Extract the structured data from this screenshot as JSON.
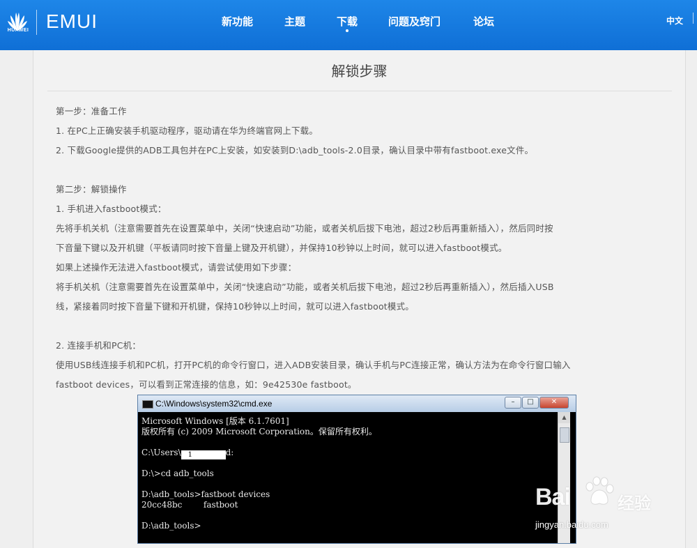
{
  "header": {
    "brand_text": "HUAWEI",
    "product_text": "EMUI",
    "nav": [
      {
        "label": "新功能",
        "active": false
      },
      {
        "label": "主题",
        "active": false
      },
      {
        "label": "下载",
        "active": true
      },
      {
        "label": "问题及窍门",
        "active": false
      },
      {
        "label": "论坛",
        "active": false
      }
    ],
    "language": "中文",
    "colors": {
      "bar": "#1676e0",
      "text": "#ffffff"
    }
  },
  "article": {
    "title": "解锁步骤",
    "lines": [
      "第一步：准备工作",
      "1. 在PC上正确安装手机驱动程序，驱动请在华为终端官网上下载。",
      "2. 下载Google提供的ADB工具包并在PC上安装，如安装到D:\\adb_tools-2.0目录，确认目录中带有fastboot.exe文件。",
      "",
      "第二步：解锁操作",
      "1. 手机进入fastboot模式：",
      "先将手机关机（注意需要首先在设置菜单中，关闭“快速启动”功能，或者关机后拔下电池，超过2秒后再重新插入），然后同时按",
      "下音量下键以及开机键（平板请同时按下音量上键及开机键），并保持10秒钟以上时间，就可以进入fastboot模式。",
      "如果上述操作无法进入fastboot模式，请尝试使用如下步骤：",
      "将手机关机（注意需要首先在设置菜单中，关闭“快速启动”功能，或者关机后拔下电池，超过2秒后再重新插入），然后插入USB",
      "线，紧接着同时按下音量下键和开机键，保持10秒钟以上时间，就可以进入fastboot模式。",
      "",
      "2. 连接手机和PC机：",
      "使用USB线连接手机和PC机，打开PC机的命令行窗口，进入ADB安装目录，确认手机与PC连接正常，确认方法为在命令行窗口输入",
      "fastboot devices，可以看到正常连接的信息，如：9e42530e fastboot。"
    ]
  },
  "cmd_window": {
    "title": "C:\\Windows\\system32\\cmd.exe",
    "buttons": {
      "minimize": "–",
      "maximize": "□",
      "close": "✕"
    },
    "lines": [
      "Microsoft Windows [版本 6.1.7601]",
      "版权所有 (c) 2009 Microsoft Corporation。保留所有权利。",
      "",
      "C:\\Users\\",
      "",
      "D:\\>cd adb_tools",
      "",
      "D:\\adb_tools>fastboot devices",
      "20cc48bc        fastboot",
      "",
      "D:\\adb_tools>"
    ],
    "redacted_fragment": "1",
    "user_line_tail": "d:"
  },
  "watermark": {
    "brand": "Bai",
    "brand_cn": "经验",
    "url": "jingyan.baidu.com"
  }
}
